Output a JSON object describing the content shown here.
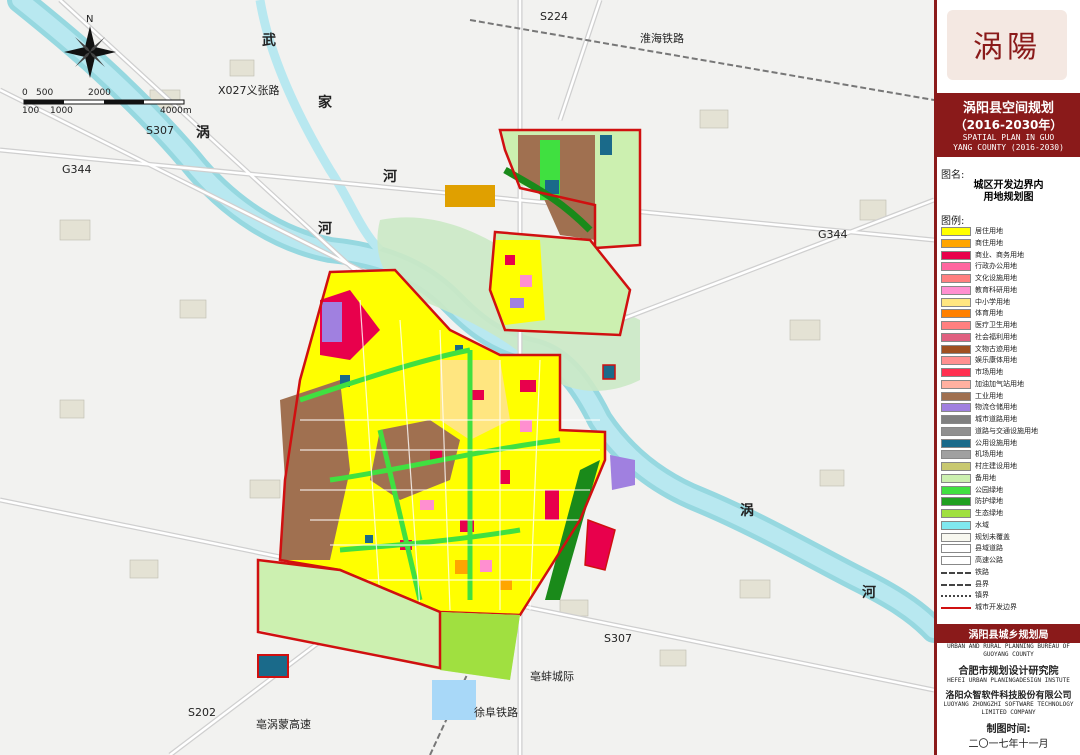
{
  "map": {
    "north": "N",
    "scale_bar": [
      "0",
      "500",
      "2000",
      "100",
      "1000",
      "4000m"
    ],
    "labels": [
      {
        "id": "wu",
        "text": "武"
      },
      {
        "id": "jia",
        "text": "家"
      },
      {
        "id": "he1",
        "text": "河"
      },
      {
        "id": "guo1",
        "text": "涡"
      },
      {
        "id": "he2",
        "text": "河"
      },
      {
        "id": "guo2",
        "text": "涡"
      },
      {
        "id": "he3",
        "text": "河"
      }
    ],
    "roads": [
      {
        "id": "s224",
        "text": "S224"
      },
      {
        "id": "huaihai",
        "text": "淮海铁路"
      },
      {
        "id": "x027",
        "text": "X027义张路"
      },
      {
        "id": "s307a",
        "text": "S307"
      },
      {
        "id": "g344a",
        "text": "G344"
      },
      {
        "id": "g344b",
        "text": "G344"
      },
      {
        "id": "s307b",
        "text": "S307"
      },
      {
        "id": "bobeng",
        "text": "亳蚌城际"
      },
      {
        "id": "xufu",
        "text": "徐阜铁路"
      },
      {
        "id": "s202",
        "text": "S202"
      },
      {
        "id": "bomeng",
        "text": "亳涡蒙高速"
      }
    ]
  },
  "sidebar": {
    "logo_text": "涡陽",
    "title_cn": "涡阳县空间规划",
    "title_years": "（2016-2030年）",
    "title_en_1": "SPATIAL PLAN IN GUO",
    "title_en_2": "YANG COUNTY (2016-2030)",
    "map_name_label": "图名:",
    "map_name_1": "城区开发边界内",
    "map_name_2": "用地规划图",
    "legend_label": "图例:",
    "legend": [
      {
        "label": "居住用地",
        "color": "#ffff00",
        "kind": "fill"
      },
      {
        "label": "商住用地",
        "color": "#ffa500",
        "kind": "fill"
      },
      {
        "label": "商业、商务用地",
        "color": "#e8004c",
        "kind": "fill"
      },
      {
        "label": "行政办公用地",
        "color": "#ff66a0",
        "kind": "fill"
      },
      {
        "label": "文化设施用地",
        "color": "#ff7f7f",
        "kind": "fill"
      },
      {
        "label": "教育科研用地",
        "color": "#ff8fd0",
        "kind": "fill"
      },
      {
        "label": "中小学用地",
        "color": "#ffe680",
        "kind": "fill"
      },
      {
        "label": "体育用地",
        "color": "#ff8000",
        "kind": "fill"
      },
      {
        "label": "医疗卫生用地",
        "color": "#ff8080",
        "kind": "fill"
      },
      {
        "label": "社会福利用地",
        "color": "#e06080",
        "kind": "fill"
      },
      {
        "label": "文物古迹用地",
        "color": "#a05020",
        "kind": "fill"
      },
      {
        "label": "娱乐康体用地",
        "color": "#ff9090",
        "kind": "fill"
      },
      {
        "label": "市场用地",
        "color": "#ff3050",
        "kind": "fill"
      },
      {
        "label": "加油加气站用地",
        "color": "#ffb0a0",
        "kind": "fill"
      },
      {
        "label": "工业用地",
        "color": "#a07050",
        "kind": "fill"
      },
      {
        "label": "物流仓储用地",
        "color": "#a080e0",
        "kind": "fill"
      },
      {
        "label": "城市道路用地",
        "color": "#808080",
        "kind": "fill"
      },
      {
        "label": "道路与交通设施用地",
        "color": "#909090",
        "kind": "fill"
      },
      {
        "label": "公用设施用地",
        "color": "#1a6a8a",
        "kind": "fill"
      },
      {
        "label": "机场用地",
        "color": "#a0a0a0",
        "kind": "fill"
      },
      {
        "label": "村庄建设用地",
        "color": "#c8c870",
        "kind": "fill"
      },
      {
        "label": "备用地",
        "color": "#ccf0b0",
        "kind": "fill"
      },
      {
        "label": "公园绿地",
        "color": "#40e040",
        "kind": "fill"
      },
      {
        "label": "防护绿地",
        "color": "#20a020",
        "kind": "fill"
      },
      {
        "label": "生态绿地",
        "color": "#a0e040",
        "kind": "fill"
      },
      {
        "label": "水域",
        "color": "#80e8f0",
        "kind": "fill"
      },
      {
        "label": "规划未覆盖",
        "color": "#f8f8f0",
        "kind": "fill"
      },
      {
        "label": "县域道路",
        "color": "#ffffff",
        "kind": "fill"
      },
      {
        "label": "高速公路",
        "color": "#ffffff",
        "kind": "fill"
      },
      {
        "label": "铁路",
        "color": "#444444",
        "kind": "rail"
      },
      {
        "label": "县界",
        "color": "#444444",
        "kind": "dash"
      },
      {
        "label": "镇界",
        "color": "#444444",
        "kind": "dashdot"
      },
      {
        "label": "城市开发边界",
        "color": "#d01010",
        "kind": "line"
      }
    ],
    "bureau": "涡阳县城乡规划局",
    "bureau_en": "URBAN AND RURAL PLANNING BUREAU OF GUOYANG COUNTY",
    "institute": "合肥市规划设计研究院",
    "institute_en": "HEFEI URBAN PLANINGADESIGN INSTUTE",
    "company": "洛阳众智软件科技股份有限公司",
    "company_en_1": "LUOYANG ZHONGZHI SOFTWARE TECHNOLOGY",
    "company_en_2": "LIMITED COMPANY",
    "date_label": "制图时间:",
    "date": "二〇一七年十一月"
  }
}
